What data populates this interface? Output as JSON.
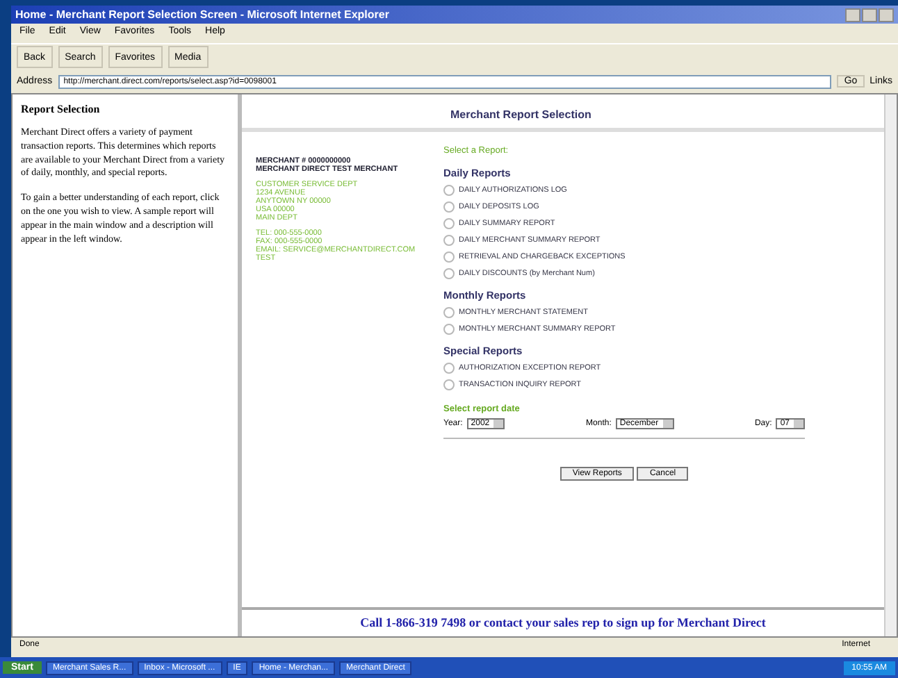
{
  "window": {
    "title": "Home - Merchant Report Selection Screen - Microsoft Internet Explorer"
  },
  "menu": [
    "File",
    "Edit",
    "View",
    "Favorites",
    "Tools",
    "Help"
  ],
  "toolbar": [
    "Back",
    "Search",
    "Favorites",
    "Media"
  ],
  "address": {
    "label": "Address",
    "value": "http://merchant.direct.com/reports/select.asp?id=0098001",
    "go": "Go",
    "links": "Links"
  },
  "sidebar": {
    "title": "Report Selection",
    "paragraphs": [
      "Merchant Direct offers a variety of payment transaction reports. This determines which reports are available to your Merchant Direct from a variety of daily, monthly, and special reports.",
      "To gain a better understanding of each report, click on the one you wish to view. A sample report will appear in the main window and a description will appear in the left window."
    ]
  },
  "page_title": "Merchant Report Selection",
  "merchant": {
    "heading": [
      "MERCHANT # 0000000000",
      "MERCHANT DIRECT TEST MERCHANT"
    ],
    "address": [
      "CUSTOMER SERVICE DEPT",
      "1234 AVENUE",
      "ANYTOWN NY 00000",
      "USA 00000",
      "MAIN DEPT"
    ],
    "contact": [
      "TEL: 000-555-0000",
      "FAX: 000-555-0000",
      "EMAIL: SERVICE@MERCHANTDIRECT.COM",
      "TEST"
    ]
  },
  "prompt": "Select a Report:",
  "sections": [
    {
      "title": "Daily Reports",
      "reports": [
        {
          "label": "DAILY AUTHORIZATIONS LOG",
          "selected": false
        },
        {
          "label": "DAILY DEPOSITS LOG",
          "selected": false
        },
        {
          "label": "DAILY SUMMARY REPORT",
          "selected": false
        },
        {
          "label": "DAILY MERCHANT SUMMARY REPORT",
          "selected": false
        },
        {
          "label": "RETRIEVAL AND CHARGEBACK EXCEPTIONS",
          "selected": false
        },
        {
          "label": "DAILY DISCOUNTS (by Merchant Num)",
          "selected": false
        }
      ]
    },
    {
      "title": "Monthly Reports",
      "reports": [
        {
          "label": "MONTHLY MERCHANT STATEMENT",
          "selected": false
        },
        {
          "label": "MONTHLY MERCHANT SUMMARY REPORT",
          "selected": false
        }
      ]
    },
    {
      "title": "Special Reports",
      "reports": [
        {
          "label": "AUTHORIZATION EXCEPTION REPORT",
          "selected": false
        },
        {
          "label": "TRANSACTION INQUIRY REPORT",
          "selected": false
        }
      ]
    }
  ],
  "date": {
    "label": "Select report date",
    "fields": [
      {
        "label": "Year:",
        "value": "2002"
      },
      {
        "label": "Month:",
        "value": "December"
      },
      {
        "label": "Day:",
        "value": "07"
      }
    ]
  },
  "buttons": [
    "View Reports",
    "Cancel"
  ],
  "banner": "Call 1-866-319 7498 or contact your sales rep to sign up for Merchant Direct",
  "status_bar": {
    "left": "Done",
    "right": "Internet"
  },
  "taskbar": {
    "start": "Start",
    "tasks": [
      "Merchant Sales R...",
      "Inbox - Microsoft ...",
      "IE",
      "Home - Merchan...",
      "Merchant Direct"
    ],
    "clock": "10:55 AM"
  }
}
